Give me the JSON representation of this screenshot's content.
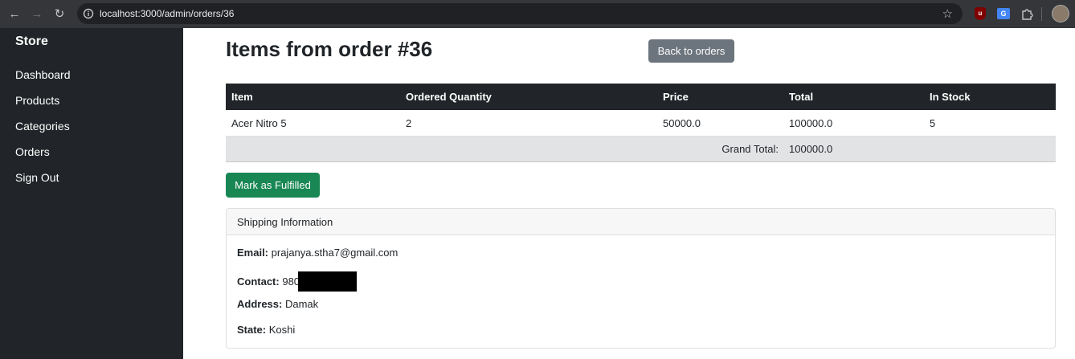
{
  "browser": {
    "url": "localhost:3000/admin/orders/36",
    "icons": [
      "back-arrow-icon",
      "forward-arrow-icon",
      "reload-icon",
      "site-info-icon",
      "star-icon",
      "ublock-icon",
      "translate-icon",
      "puzzle-icon",
      "profile-avatar"
    ]
  },
  "sidebar": {
    "brand": "Store",
    "items": [
      {
        "label": "Dashboard"
      },
      {
        "label": "Products"
      },
      {
        "label": "Categories"
      },
      {
        "label": "Orders"
      },
      {
        "label": "Sign Out"
      }
    ]
  },
  "main": {
    "title": "Items from order #36",
    "back_label": "Back to orders",
    "table": {
      "headers": [
        "Item",
        "Ordered Quantity",
        "Price",
        "Total",
        "In Stock"
      ],
      "rows": [
        [
          "Acer Nitro 5",
          "2",
          "50000.0",
          "100000.0",
          "5"
        ]
      ],
      "grand_total_label": "Grand Total:",
      "grand_total_value": "100000.0"
    },
    "fulfill_label": "Mark as Fulfilled",
    "shipping": {
      "header": "Shipping Information",
      "email_label": "Email:",
      "email_value": "prajanya.stha7@gmail.com",
      "contact_label": "Contact:",
      "contact_value": "980",
      "address_label": "Address:",
      "address_value": "Damak",
      "state_label": "State:",
      "state_value": "Koshi"
    }
  },
  "colors": {
    "sidebar_bg": "#212529",
    "table_header_bg": "#212529",
    "back_button": "#6c757d",
    "fulfill_button": "#198754",
    "grand_total_bg": "#e2e3e5"
  }
}
